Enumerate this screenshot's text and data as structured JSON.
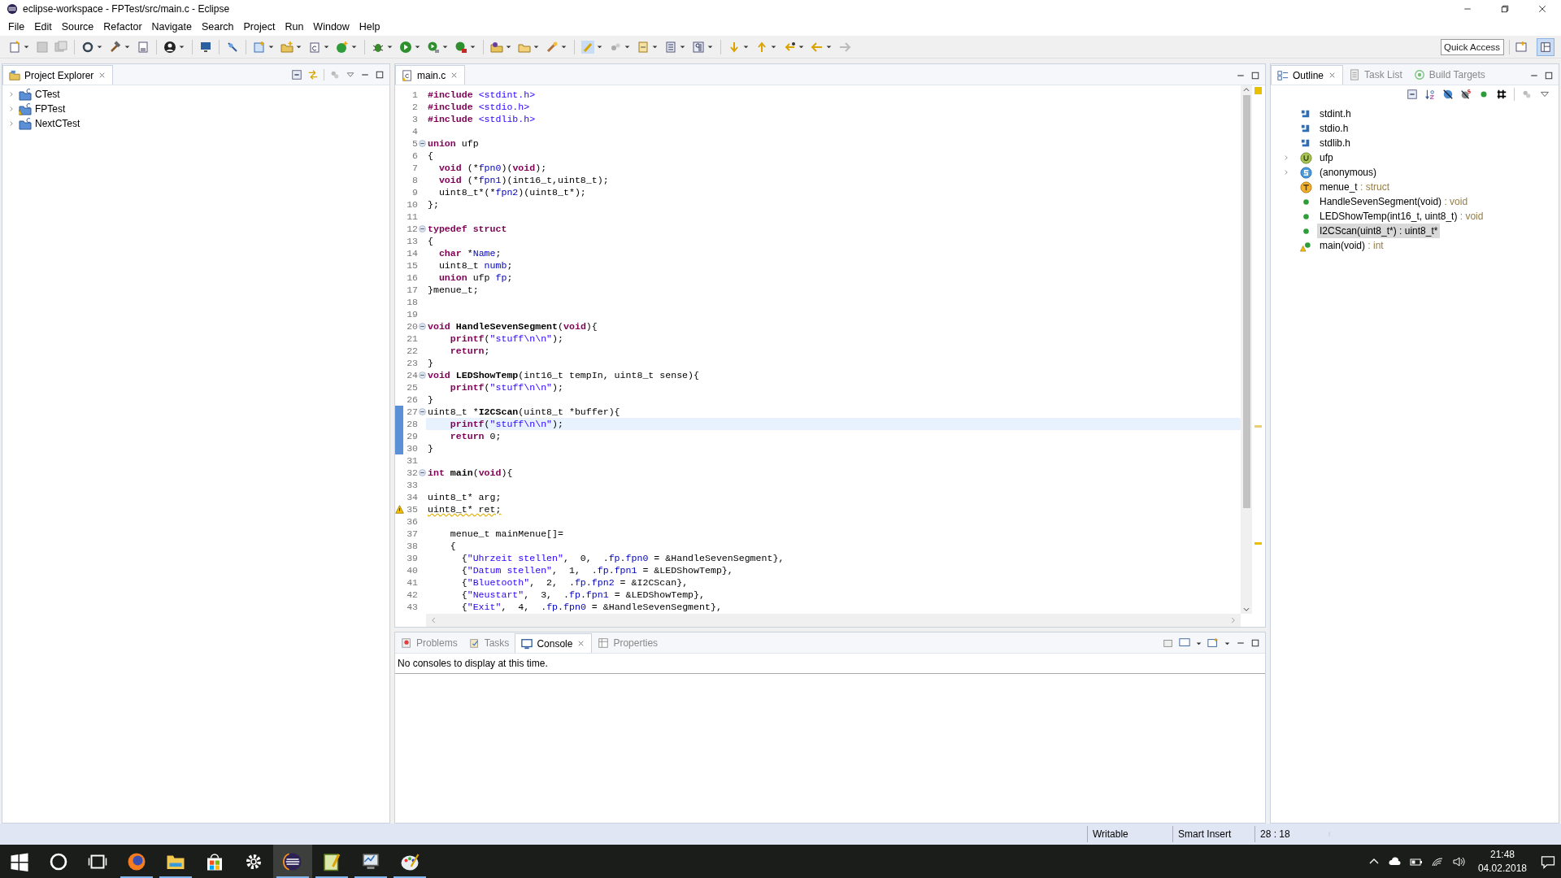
{
  "window": {
    "title": "eclipse-workspace - FPTest/src/main.c - Eclipse"
  },
  "menu": [
    "File",
    "Edit",
    "Source",
    "Refactor",
    "Navigate",
    "Search",
    "Project",
    "Run",
    "Window",
    "Help"
  ],
  "quick_access": {
    "placeholder": "Quick Access"
  },
  "project_explorer": {
    "tab": {
      "label": "Project Explorer",
      "selected": true
    },
    "items": [
      {
        "label": "CTest",
        "warning": false
      },
      {
        "label": "FPTest",
        "warning": true
      },
      {
        "label": "NextCTest",
        "warning": false
      }
    ]
  },
  "editor": {
    "tabs": [
      {
        "label": "main.c",
        "selected": true
      }
    ],
    "lines": [
      {
        "n": "1",
        "segments": [
          {
            "text": "#include",
            "kind": "kw"
          },
          {
            "text": " <stdint.h>",
            "kind": "str"
          }
        ]
      },
      {
        "n": "2",
        "segments": [
          {
            "text": "#include",
            "kind": "kw"
          },
          {
            "text": " <stdio.h>",
            "kind": "str"
          }
        ]
      },
      {
        "n": "3",
        "segments": [
          {
            "text": "#include",
            "kind": "kw"
          },
          {
            "text": " <stdlib.h>",
            "kind": "str"
          }
        ]
      },
      {
        "n": "4"
      },
      {
        "n": "5",
        "fold": true,
        "segments": [
          {
            "text": "union",
            "kind": "kw"
          },
          {
            "text": " ufp",
            "kind": "plain"
          }
        ]
      },
      {
        "n": "6",
        "segments": [
          {
            "text": "{",
            "kind": "plain"
          }
        ]
      },
      {
        "n": "7",
        "segments": [
          {
            "text": "  void",
            "kind": "kw"
          },
          {
            "text": " (*",
            "kind": "plain"
          },
          {
            "text": "fpn0",
            "kind": "field"
          },
          {
            "text": ")(",
            "kind": "plain"
          },
          {
            "text": "void",
            "kind": "kw"
          },
          {
            "text": ");",
            "kind": "plain"
          }
        ]
      },
      {
        "n": "8",
        "segments": [
          {
            "text": "  void",
            "kind": "kw"
          },
          {
            "text": " (*",
            "kind": "plain"
          },
          {
            "text": "fpn1",
            "kind": "field"
          },
          {
            "text": ")(int16_t,uint8_t);",
            "kind": "plain"
          }
        ]
      },
      {
        "n": "9",
        "segments": [
          {
            "text": "  uint8_t*(*",
            "kind": "plain"
          },
          {
            "text": "fpn2",
            "kind": "field"
          },
          {
            "text": ")(uint8_t*);",
            "kind": "plain"
          }
        ]
      },
      {
        "n": "10",
        "segments": [
          {
            "text": "};",
            "kind": "plain"
          }
        ]
      },
      {
        "n": "11"
      },
      {
        "n": "12",
        "fold": true,
        "segments": [
          {
            "text": "typedef struct",
            "kind": "kw"
          }
        ]
      },
      {
        "n": "13",
        "segments": [
          {
            "text": "{",
            "kind": "plain"
          }
        ]
      },
      {
        "n": "14",
        "segments": [
          {
            "text": "  char",
            "kind": "kw"
          },
          {
            "text": " *",
            "kind": "plain"
          },
          {
            "text": "Name",
            "kind": "field"
          },
          {
            "text": ";",
            "kind": "plain"
          }
        ]
      },
      {
        "n": "15",
        "segments": [
          {
            "text": "  uint8_t ",
            "kind": "plain"
          },
          {
            "text": "numb",
            "kind": "field"
          },
          {
            "text": ";",
            "kind": "plain"
          }
        ]
      },
      {
        "n": "16",
        "segments": [
          {
            "text": "  union",
            "kind": "kw"
          },
          {
            "text": " ufp ",
            "kind": "plain"
          },
          {
            "text": "fp",
            "kind": "field"
          },
          {
            "text": ";",
            "kind": "plain"
          }
        ]
      },
      {
        "n": "17",
        "segments": [
          {
            "text": "}menue_t;",
            "kind": "plain"
          }
        ]
      },
      {
        "n": "18"
      },
      {
        "n": "19"
      },
      {
        "n": "20",
        "fold": true,
        "segments": [
          {
            "text": "void",
            "kind": "kw"
          },
          {
            "text": " HandleSevenSegment",
            "kind": "fn"
          },
          {
            "text": "(",
            "kind": "plain"
          },
          {
            "text": "void",
            "kind": "kw"
          },
          {
            "text": "){",
            "kind": "plain"
          }
        ]
      },
      {
        "n": "21",
        "segments": [
          {
            "text": "    printf",
            "kind": "kw"
          },
          {
            "text": "(",
            "kind": "plain"
          },
          {
            "text": "\"stuff\\n\\n\"",
            "kind": "str"
          },
          {
            "text": ");",
            "kind": "plain"
          }
        ]
      },
      {
        "n": "22",
        "segments": [
          {
            "text": "    return",
            "kind": "kw"
          },
          {
            "text": ";",
            "kind": "plain"
          }
        ]
      },
      {
        "n": "23",
        "segments": [
          {
            "text": "}",
            "kind": "plain"
          }
        ]
      },
      {
        "n": "24",
        "fold": true,
        "segments": [
          {
            "text": "void",
            "kind": "kw"
          },
          {
            "text": " LEDShowTemp",
            "kind": "fn"
          },
          {
            "text": "(int16_t tempIn, uint8_t sense){",
            "kind": "plain"
          }
        ]
      },
      {
        "n": "25",
        "segments": [
          {
            "text": "    printf",
            "kind": "kw"
          },
          {
            "text": "(",
            "kind": "plain"
          },
          {
            "text": "\"stuff\\n\\n\"",
            "kind": "str"
          },
          {
            "text": ");",
            "kind": "plain"
          }
        ]
      },
      {
        "n": "26",
        "segments": [
          {
            "text": "}",
            "kind": "plain"
          }
        ]
      },
      {
        "n": "27",
        "fold": true,
        "changed": true,
        "segments": [
          {
            "text": "uint8_t *",
            "kind": "plain"
          },
          {
            "text": "I2CScan",
            "kind": "fn"
          },
          {
            "text": "(uint8_t *buffer){",
            "kind": "plain"
          }
        ]
      },
      {
        "n": "28",
        "changed": true,
        "current": true,
        "segments": [
          {
            "text": "    printf",
            "kind": "kw"
          },
          {
            "text": "(",
            "kind": "plain"
          },
          {
            "text": "\"stuff\\n\\n\"",
            "kind": "str"
          },
          {
            "text": ");",
            "kind": "plain"
          }
        ]
      },
      {
        "n": "29",
        "changed": true,
        "segments": [
          {
            "text": "    return",
            "kind": "kw"
          },
          {
            "text": " 0;",
            "kind": "plain"
          }
        ]
      },
      {
        "n": "30",
        "changed": true,
        "segments": [
          {
            "text": "}",
            "kind": "plain"
          }
        ]
      },
      {
        "n": "31"
      },
      {
        "n": "32",
        "fold": true,
        "segments": [
          {
            "text": "int",
            "kind": "kw"
          },
          {
            "text": " main",
            "kind": "fn"
          },
          {
            "text": "(",
            "kind": "plain"
          },
          {
            "text": "void",
            "kind": "kw"
          },
          {
            "text": "){",
            "kind": "plain"
          }
        ]
      },
      {
        "n": "33"
      },
      {
        "n": "34",
        "segments": [
          {
            "text": "uint8_t* arg;",
            "kind": "plain"
          }
        ]
      },
      {
        "n": "35",
        "warning": true,
        "segments": [
          {
            "text": "uint8_t* ret;",
            "kind": "warn"
          }
        ]
      },
      {
        "n": "36"
      },
      {
        "n": "37",
        "segments": [
          {
            "text": "    menue_t mainMenue[]=",
            "kind": "plain"
          }
        ]
      },
      {
        "n": "38",
        "segments": [
          {
            "text": "    {",
            "kind": "plain"
          }
        ]
      },
      {
        "n": "39",
        "segments": [
          {
            "text": "      {",
            "kind": "plain"
          },
          {
            "text": "\"Uhrzeit stellen\"",
            "kind": "str"
          },
          {
            "text": ",  0,  .",
            "kind": "plain"
          },
          {
            "text": "fp",
            "kind": "field"
          },
          {
            "text": ".",
            "kind": "plain"
          },
          {
            "text": "fpn0",
            "kind": "field"
          },
          {
            "text": " = &HandleSevenSegment},",
            "kind": "plain"
          }
        ]
      },
      {
        "n": "40",
        "segments": [
          {
            "text": "      {",
            "kind": "plain"
          },
          {
            "text": "\"Datum stellen\"",
            "kind": "str"
          },
          {
            "text": ",  1,  .",
            "kind": "plain"
          },
          {
            "text": "fp",
            "kind": "field"
          },
          {
            "text": ".",
            "kind": "plain"
          },
          {
            "text": "fpn1",
            "kind": "field"
          },
          {
            "text": " = &LEDShowTemp},",
            "kind": "plain"
          }
        ]
      },
      {
        "n": "41",
        "segments": [
          {
            "text": "      {",
            "kind": "plain"
          },
          {
            "text": "\"Bluetooth\"",
            "kind": "str"
          },
          {
            "text": ",  2,  .",
            "kind": "plain"
          },
          {
            "text": "fp",
            "kind": "field"
          },
          {
            "text": ".",
            "kind": "plain"
          },
          {
            "text": "fpn2",
            "kind": "field"
          },
          {
            "text": " = &I2CScan},",
            "kind": "plain"
          }
        ]
      },
      {
        "n": "42",
        "segments": [
          {
            "text": "      {",
            "kind": "plain"
          },
          {
            "text": "\"Neustart\"",
            "kind": "str"
          },
          {
            "text": ",  3,  .",
            "kind": "plain"
          },
          {
            "text": "fp",
            "kind": "field"
          },
          {
            "text": ".",
            "kind": "plain"
          },
          {
            "text": "fpn1",
            "kind": "field"
          },
          {
            "text": " = &LEDShowTemp},",
            "kind": "plain"
          }
        ]
      },
      {
        "n": "43",
        "segments": [
          {
            "text": "      {",
            "kind": "plain"
          },
          {
            "text": "\"Exit\"",
            "kind": "str"
          },
          {
            "text": ",  4,  .",
            "kind": "plain"
          },
          {
            "text": "fp",
            "kind": "field"
          },
          {
            "text": ".",
            "kind": "plain"
          },
          {
            "text": "fpn0",
            "kind": "field"
          },
          {
            "text": " = &HandleSevenSegment},",
            "kind": "plain"
          }
        ]
      }
    ]
  },
  "outline": {
    "tabs": [
      {
        "label": "Outline",
        "selected": true
      },
      {
        "label": "Task List",
        "selected": false
      },
      {
        "label": "Build Targets",
        "selected": false
      }
    ],
    "items": [
      {
        "kind": "include",
        "label": "stdint.h",
        "has_children": false,
        "selected": false
      },
      {
        "kind": "include",
        "label": "stdio.h",
        "has_children": false,
        "selected": false
      },
      {
        "kind": "include",
        "label": "stdlib.h",
        "has_children": false,
        "selected": false
      },
      {
        "kind": "union",
        "label": "ufp",
        "has_children": true,
        "selected": false
      },
      {
        "kind": "struct",
        "label": "(anonymous)",
        "has_children": true,
        "selected": false
      },
      {
        "kind": "typedef",
        "label": "menue_t",
        "type": " : struct",
        "has_children": false,
        "selected": false
      },
      {
        "kind": "function",
        "label": "HandleSevenSegment(void)",
        "type": " : void",
        "has_children": false,
        "selected": false
      },
      {
        "kind": "function",
        "label": "LEDShowTemp(int16_t, uint8_t)",
        "type": " : void",
        "has_children": false,
        "selected": false
      },
      {
        "kind": "function",
        "label": "I2CScan(uint8_t*) : uint8_t*",
        "has_children": false,
        "selected": true
      },
      {
        "kind": "function_warning",
        "label": "main(void)",
        "type": " : int",
        "has_children": false,
        "selected": false
      }
    ]
  },
  "bottom_panel": {
    "tabs": [
      {
        "label": "Problems",
        "selected": false
      },
      {
        "label": "Tasks",
        "selected": false
      },
      {
        "label": "Console",
        "selected": true
      },
      {
        "label": "Properties",
        "selected": false
      }
    ],
    "message": "No consoles to display at this time."
  },
  "status_bar": [
    "Writable",
    "Smart Insert",
    "28 : 18"
  ],
  "taskbar": {
    "time": "21:48",
    "date": "04.02.2018"
  }
}
